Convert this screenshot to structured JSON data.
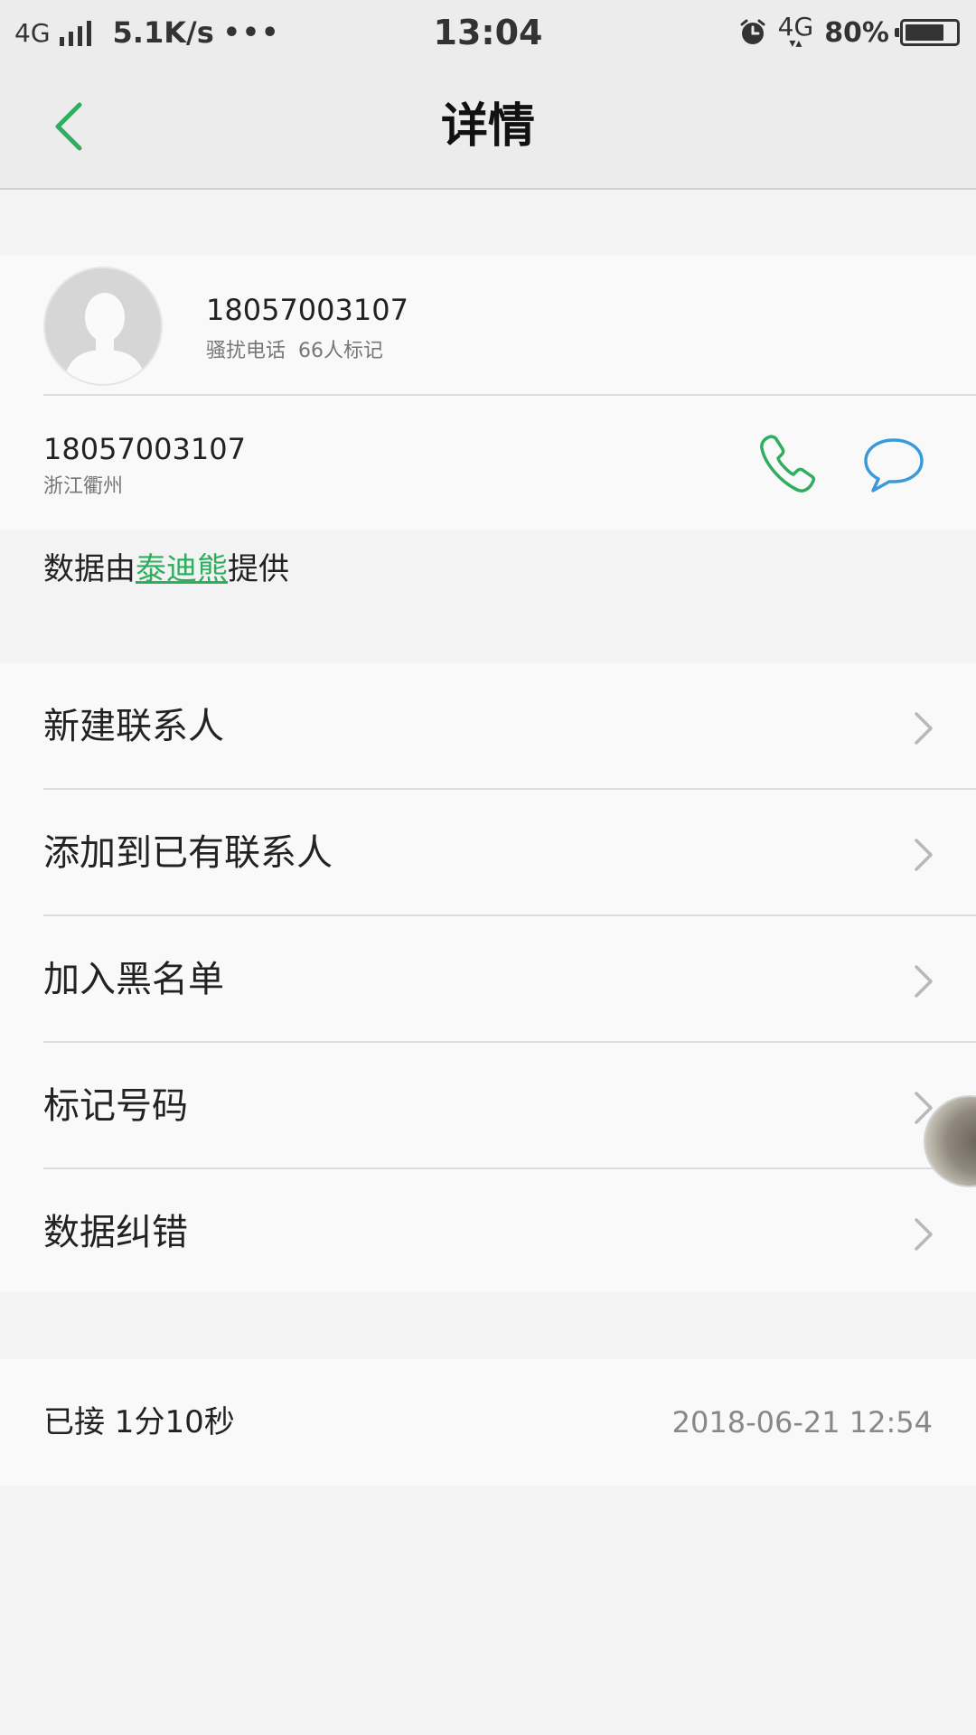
{
  "status_bar": {
    "network_left": "4G",
    "speed": "5.1K/s",
    "dots": "•••",
    "time": "13:04",
    "network_right": "4G",
    "battery_percent": "80%",
    "battery_level": 0.8
  },
  "header": {
    "title": "详情"
  },
  "profile": {
    "number": "18057003107",
    "tag": "骚扰电话",
    "mark_count": "66人标记"
  },
  "number_row": {
    "number": "18057003107",
    "location": "浙江衢州"
  },
  "provider": {
    "prefix": "数据由",
    "name": "泰迪熊",
    "suffix": "提供"
  },
  "menu": {
    "items": [
      {
        "label": "新建联系人"
      },
      {
        "label": "添加到已有联系人"
      },
      {
        "label": "加入黑名单"
      },
      {
        "label": "标记号码"
      },
      {
        "label": "数据纠错"
      }
    ]
  },
  "call_record": {
    "status": "已接 1分10秒",
    "datetime": "2018-06-21 12:54"
  },
  "colors": {
    "accent_green": "#2eae5e",
    "sms_blue": "#3a9ad9"
  },
  "icons": {
    "back": "chevron-left-icon",
    "call": "phone-icon",
    "sms": "message-bubble-icon",
    "row_chevron": "chevron-right-icon"
  }
}
